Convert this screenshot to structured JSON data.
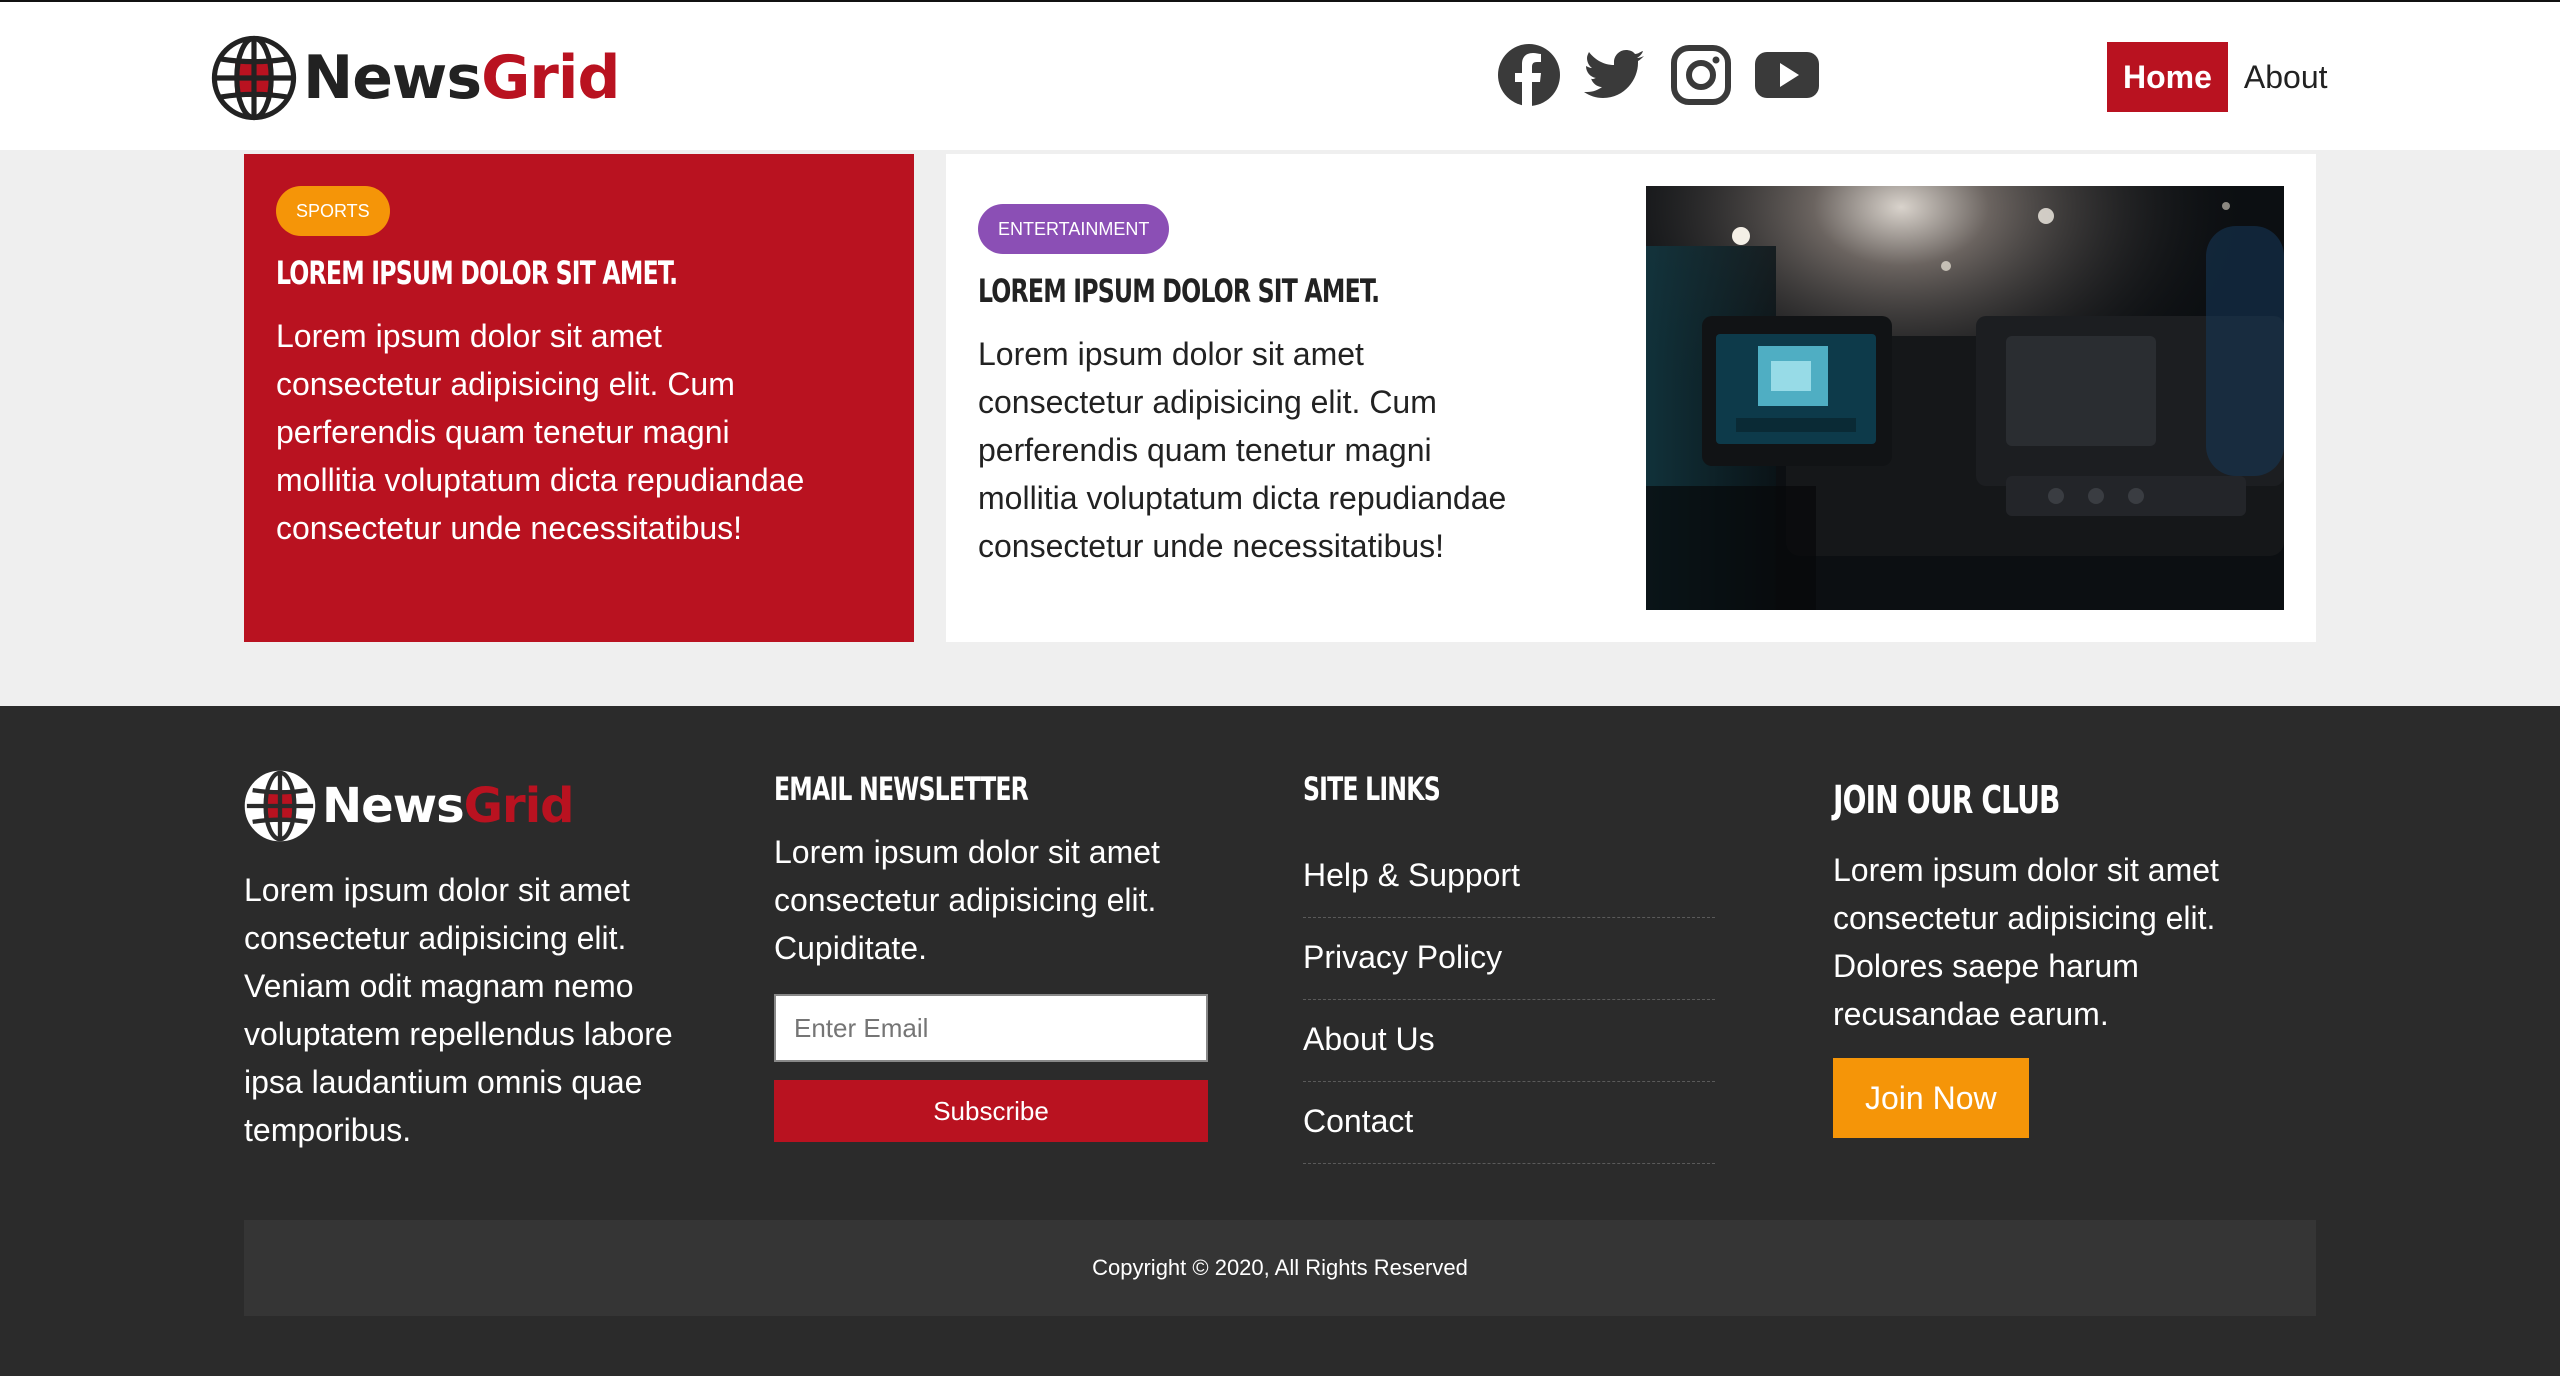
{
  "brand": {
    "part1": "News",
    "part2": "Grid"
  },
  "social": [
    "facebook-icon",
    "twitter-icon",
    "instagram-icon",
    "youtube-icon"
  ],
  "nav": {
    "home": "Home",
    "about": "About"
  },
  "cards": {
    "sports": {
      "badge": "Sports",
      "title": "Lorem ipsum dolor sit amet.",
      "text": "Lorem ipsum dolor sit amet consectetur adipisicing elit. Cum perferendis quam tenetur magni mollitia voluptatum dicta repudiandae consectetur unde necessitatibus!"
    },
    "entertainment": {
      "badge": "Entertainment",
      "title": "Lorem ipsum dolor sit amet.",
      "text": "Lorem ipsum dolor sit amet consectetur adipisicing elit. Cum perferendis quam tenetur magni mollitia voluptatum dicta repudiandae consectetur unde necessitatibus!"
    }
  },
  "footer": {
    "about": "Lorem ipsum dolor sit amet consectetur adipisicing elit. Veniam odit magnam nemo voluptatem repellendus labore ipsa laudantium omnis quae temporibus.",
    "newsletter": {
      "title": "Email Newsletter",
      "text": "Lorem ipsum dolor sit amet consectetur adipisicing elit. Cupiditate.",
      "placeholder": "Enter Email",
      "button": "Subscribe"
    },
    "site_links": {
      "title": "Site Links",
      "items": [
        "Help & Support",
        "Privacy Policy",
        "About Us",
        "Contact"
      ]
    },
    "club": {
      "title": "Join Our Club",
      "text": "Lorem ipsum dolor sit amet consectetur adipisicing elit. Dolores saepe harum recusandae earum.",
      "button": "Join Now"
    },
    "copyright": "Copyright © 2020, All Rights Reserved"
  },
  "colors": {
    "primary": "#b91220",
    "secondary": "#f59508",
    "purple": "#8b4fb5",
    "dark": "#2b2b2b"
  }
}
